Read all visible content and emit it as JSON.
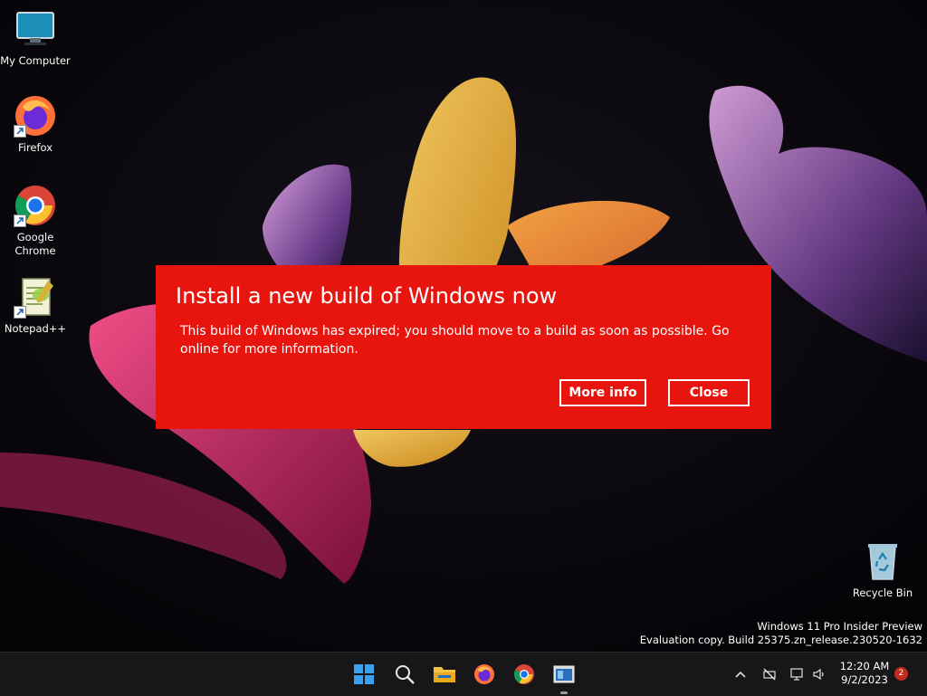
{
  "desktop": {
    "icons": [
      {
        "label": "My Computer",
        "icon": "monitor-icon"
      },
      {
        "label": "Firefox",
        "icon": "firefox-icon"
      },
      {
        "label": "Google\nChrome",
        "icon": "chrome-icon"
      },
      {
        "label": "Notepad++",
        "icon": "notepadpp-icon"
      },
      {
        "label": "Recycle Bin",
        "icon": "recycle-bin-icon"
      }
    ]
  },
  "dialog": {
    "title": "Install a new build of Windows now",
    "message": "This build of Windows has expired; you should move to a build as soon as possible. Go online for more information.",
    "more_info_label": "More info",
    "close_label": "Close",
    "background_color": "#e8150f"
  },
  "watermark": {
    "line1": "Windows 11 Pro Insider Preview",
    "line2": "Evaluation copy. Build 25375.zn_release.230520-1632"
  },
  "taskbar": {
    "apps": [
      "start-icon",
      "search-icon",
      "file-explorer-icon",
      "firefox-icon",
      "chrome-icon",
      "window-app-icon"
    ],
    "tray": [
      "chevron-up-icon",
      "network-off-icon",
      "monitor-icon",
      "volume-icon"
    ],
    "time": "12:20 AM",
    "date": "9/2/2023",
    "notification_count": "2"
  }
}
